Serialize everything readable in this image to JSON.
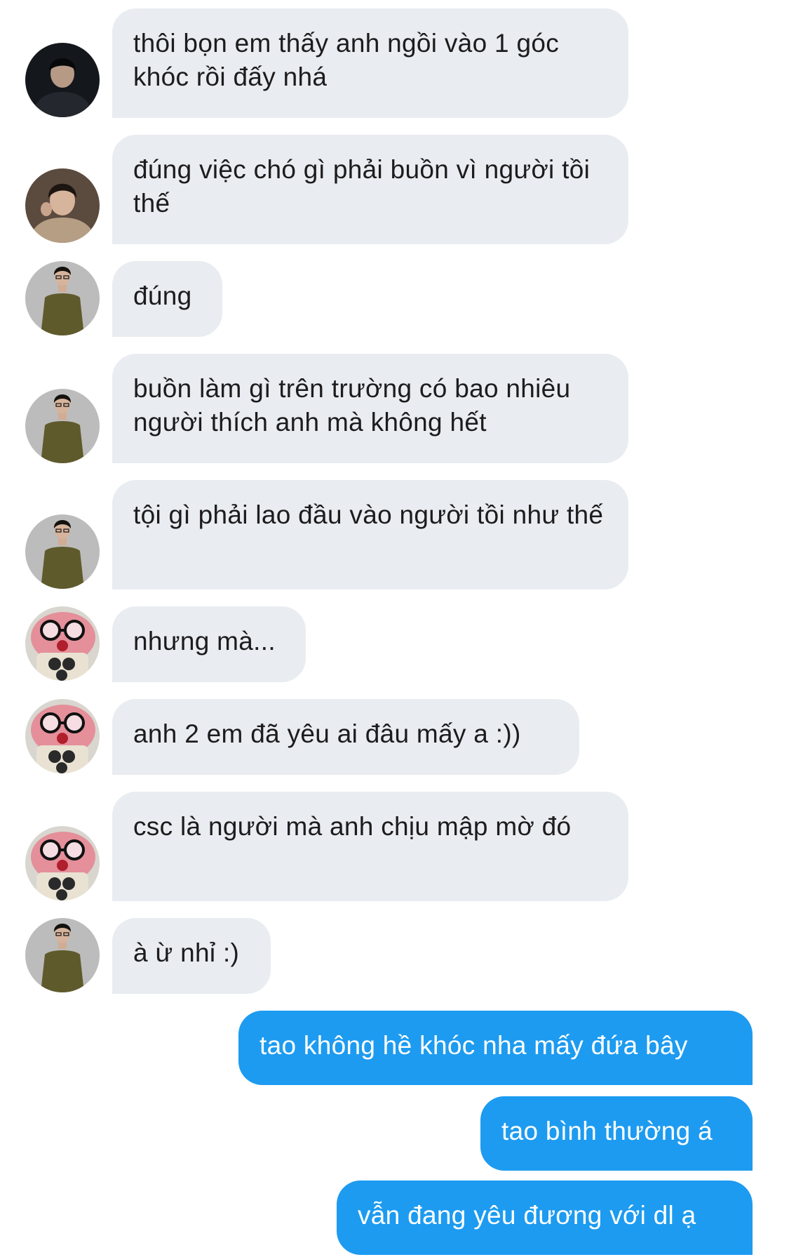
{
  "colors": {
    "incoming_bubble": "#e9ecf0",
    "outgoing_bubble": "#1d9bf0",
    "incoming_text": "#1c1c1e",
    "outgoing_text": "#ffffff"
  },
  "messages": [
    {
      "direction": "in",
      "avatar": "avatar-dark-jacket",
      "text": "thôi bọn em thấy anh ngồi vào 1 góc khóc rồi đấy nhá"
    },
    {
      "direction": "in",
      "avatar": "avatar-boy-hoodie",
      "text": "đúng việc chó gì phải buồn vì người tồi thế"
    },
    {
      "direction": "in",
      "avatar": "avatar-glasses-olive-shirt",
      "text": "đúng"
    },
    {
      "direction": "in",
      "avatar": "avatar-glasses-olive-shirt",
      "text": "buồn làm gì trên trường có bao nhiêu người thích anh mà không hết"
    },
    {
      "direction": "in",
      "avatar": "avatar-glasses-olive-shirt",
      "text": "tội gì phải lao đầu vào người tồi như thế"
    },
    {
      "direction": "in",
      "avatar": "avatar-pink-plush-glasses",
      "text": "nhưng mà..."
    },
    {
      "direction": "in",
      "avatar": "avatar-pink-plush-glasses",
      "text": "anh 2 em đã yêu ai đâu mấy a :))"
    },
    {
      "direction": "in",
      "avatar": "avatar-pink-plush-glasses",
      "text": "csc là người mà anh chịu mập mờ đó"
    },
    {
      "direction": "in",
      "avatar": "avatar-glasses-olive-shirt",
      "text": "à ừ nhỉ :)"
    },
    {
      "direction": "out",
      "text": "tao không hề khóc nha mấy đứa bây"
    },
    {
      "direction": "out",
      "text": "tao bình thường á"
    },
    {
      "direction": "out",
      "text": "vẫn đang yêu đương với dl ạ"
    }
  ]
}
